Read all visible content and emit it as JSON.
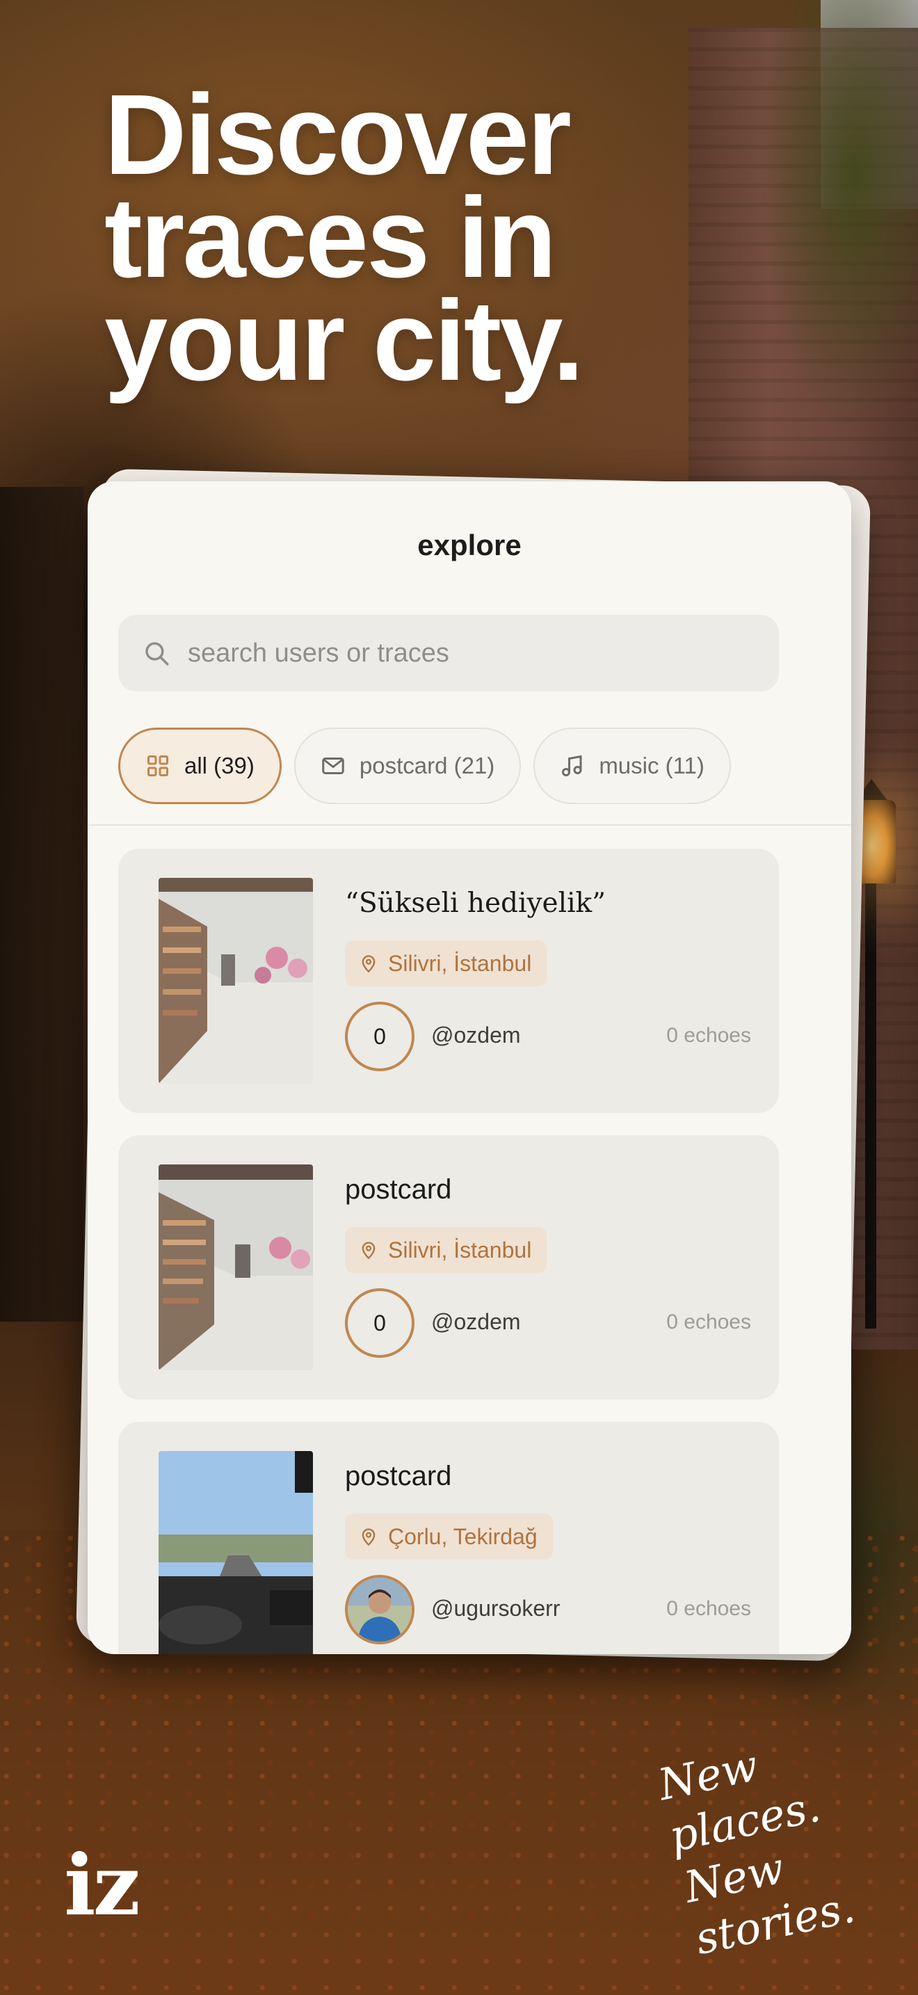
{
  "headline": {
    "line1": "Discover",
    "line2": "traces in",
    "line3": "your city."
  },
  "screen": {
    "title": "explore",
    "search": {
      "placeholder": "search users or traces"
    },
    "filters": [
      {
        "label": "all (39)",
        "icon": "grid-icon",
        "active": true
      },
      {
        "label": "postcard (21)",
        "icon": "envelope-icon",
        "active": false
      },
      {
        "label": "music (11)",
        "icon": "music-note-icon",
        "active": false
      }
    ],
    "traces": [
      {
        "title": "“Sükseli hediyelik”",
        "location": "Silivri, İstanbul",
        "echo_count": "0",
        "username": "@ozdem",
        "echoes": "0 echoes"
      },
      {
        "title": "postcard",
        "location": "Silivri, İstanbul",
        "echo_count": "0",
        "username": "@ozdem",
        "echoes": "0 echoes"
      },
      {
        "title": "postcard",
        "location": "Çorlu, Tekirdağ",
        "username": "@ugursokerr",
        "echoes": "0 echoes"
      }
    ]
  },
  "tagline": {
    "line1": "New places.",
    "line2": "New stories."
  },
  "brand": {
    "logo": "iz"
  },
  "colors": {
    "accent": "#c0874f",
    "location_text": "#b0733c",
    "card_bg": "#f9f7f1"
  }
}
